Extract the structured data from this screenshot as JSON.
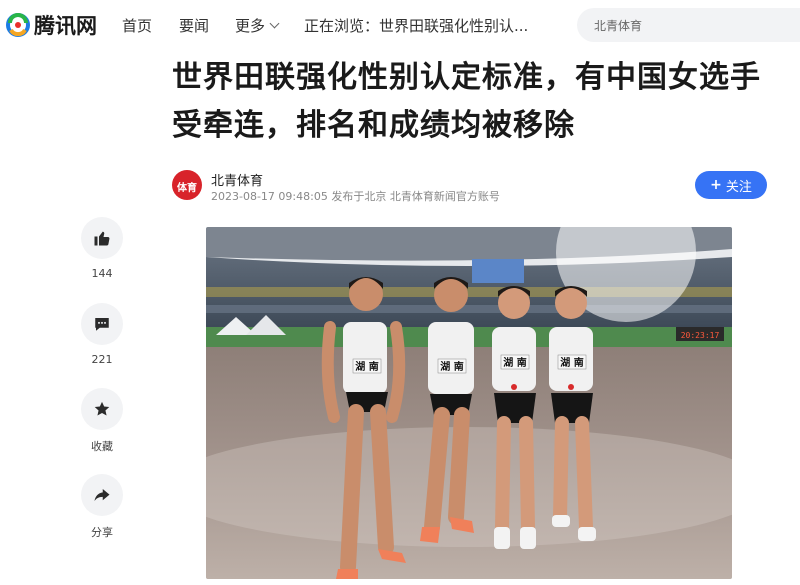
{
  "header": {
    "logo_text": "腾讯网",
    "nav": {
      "home": "首页",
      "news": "要闻",
      "more": "更多"
    },
    "browsing": "正在浏览：世界田联强化性别认...",
    "search_placeholder": "北青体育"
  },
  "article": {
    "title": "世界田联强化性别认定标准，有中国女选手受牵连，排名和成绩均被移除",
    "author": {
      "name": "北青体育",
      "avatar_text": "体育",
      "meta": "2023-08-17 09:48:05  发布于北京  北青体育新闻官方账号"
    },
    "follow_label": "关注"
  },
  "actions": {
    "like_count": "144",
    "comment_count": "221",
    "favorite_label": "收藏",
    "share_label": "分享"
  },
  "photo": {
    "bib_text": "湖 南",
    "scoreboard_text": "20:23:17"
  },
  "colors": {
    "accent": "#3673f5",
    "avatar_red": "#d8232a",
    "action_bg": "#f2f3f5"
  },
  "icons": [
    "tencent-logo-icon",
    "chevron-down-icon",
    "thumbs-up-icon",
    "comment-icon",
    "star-icon",
    "share-icon"
  ]
}
